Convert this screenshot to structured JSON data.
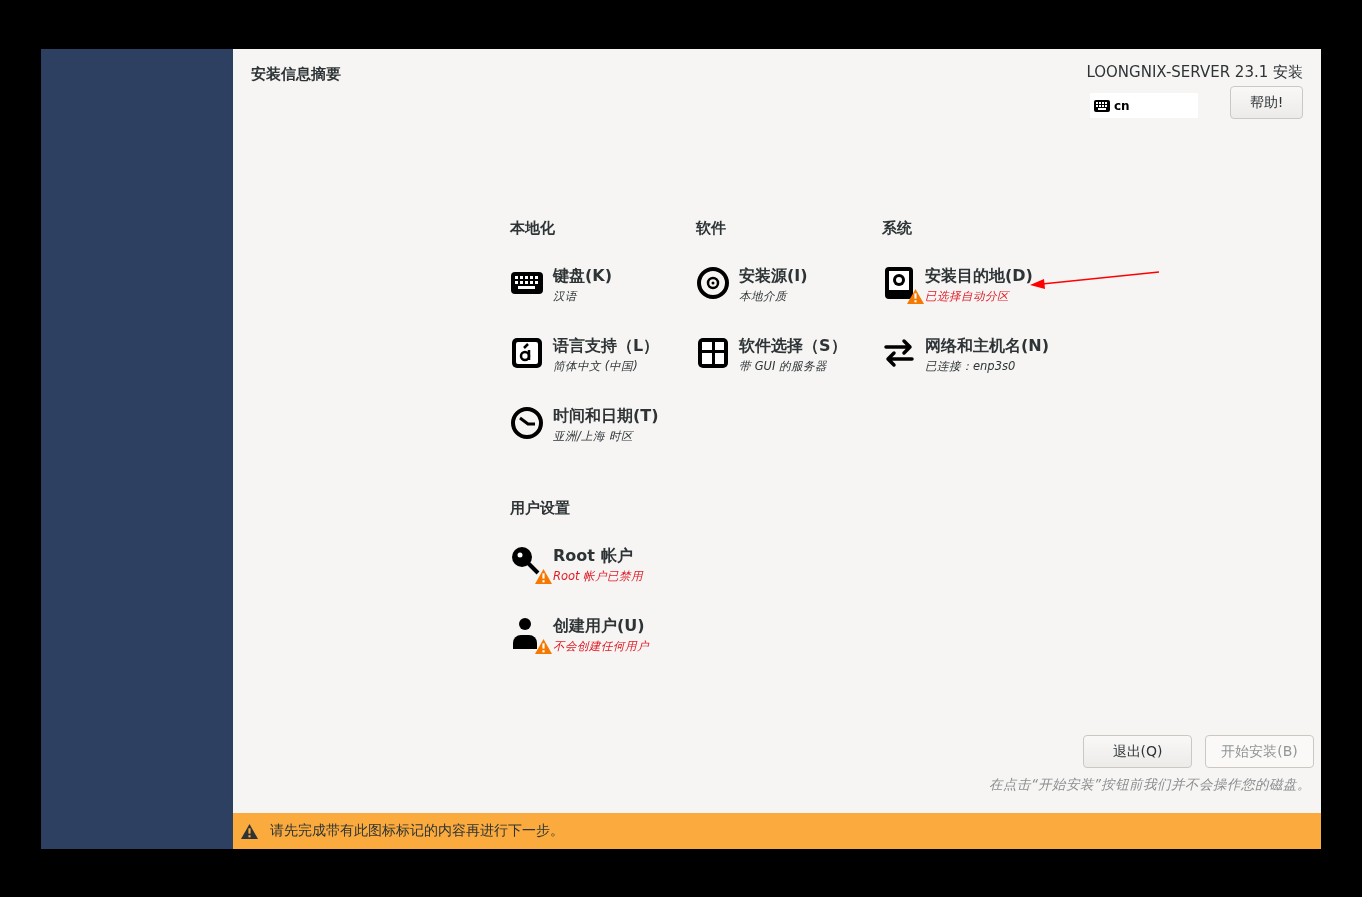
{
  "header": {
    "title": "安装信息摘要",
    "product": "LOONGNIX-SERVER 23.1 安装",
    "keyboard_layout": "cn",
    "help_button": "帮助!"
  },
  "sections": [
    {
      "title": "本地化",
      "items": [
        {
          "kind": "keyboard",
          "title": "键盘(K)",
          "status": "汉语",
          "warning": false
        },
        {
          "kind": "language",
          "title": "语言支持（L）",
          "status": "简体中文 (中国)",
          "warning": false
        },
        {
          "kind": "clock",
          "title": "时间和日期(T)",
          "status": "亚洲/上海 时区",
          "warning": false
        }
      ]
    },
    {
      "title": "软件",
      "items": [
        {
          "kind": "disc",
          "title": "安装源(I)",
          "status": "本地介质",
          "warning": false
        },
        {
          "kind": "package",
          "title": "软件选择（S）",
          "status": "带 GUI 的服务器",
          "warning": false
        }
      ]
    },
    {
      "title": "系统",
      "items": [
        {
          "kind": "drive",
          "title": "安装目的地(D)",
          "status": "已选择自动分区",
          "warning": true
        },
        {
          "kind": "network",
          "title": "网络和主机名(N)",
          "status": "已连接：enp3s0",
          "warning": false
        }
      ]
    },
    {
      "title": "用户设置",
      "items": [
        {
          "kind": "key",
          "title": "Root 帐户",
          "status": "Root 帐户已禁用",
          "warning": true
        },
        {
          "kind": "user",
          "title": "创建用户(U)",
          "status": "不会创建任何用户",
          "warning": true
        }
      ]
    }
  ],
  "quit_button": {
    "label": "退出(Q)",
    "disabled": false
  },
  "begin_button": {
    "label": "开始安装(B)",
    "disabled": true
  },
  "note": "在点击“开始安装”按钮前我们并不会操作您的磁盘。",
  "warning_bar": {
    "message": "请先完成带有此图标标记的内容再进行下一步。"
  }
}
